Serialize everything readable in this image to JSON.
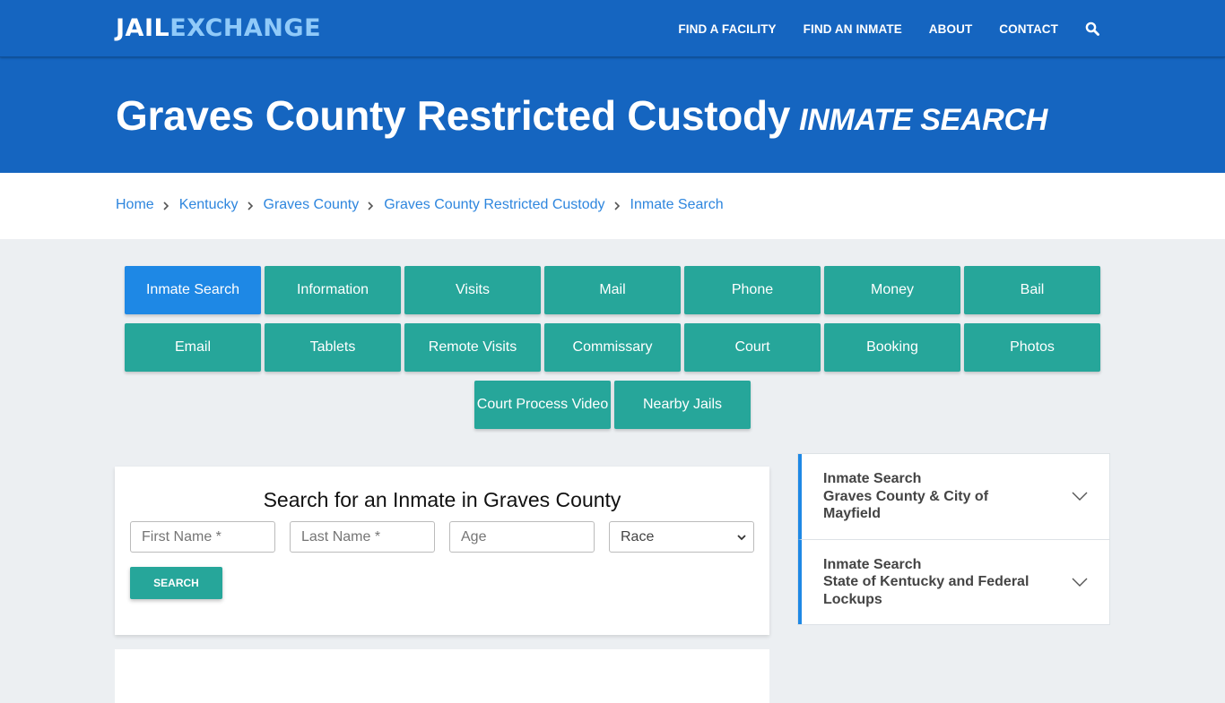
{
  "brand": {
    "part1": "JAIL",
    "part2": "EXCHANGE"
  },
  "nav": {
    "items": [
      {
        "label": "FIND A FACILITY"
      },
      {
        "label": "FIND AN INMATE"
      },
      {
        "label": "ABOUT"
      },
      {
        "label": "CONTACT"
      }
    ],
    "search_icon": "search-icon"
  },
  "hero": {
    "title": "Graves County Restricted Custody",
    "subtitle": "INMATE SEARCH"
  },
  "breadcrumb": [
    {
      "label": "Home"
    },
    {
      "label": "Kentucky"
    },
    {
      "label": "Graves County"
    },
    {
      "label": "Graves County Restricted Custody"
    },
    {
      "label": "Inmate Search"
    }
  ],
  "tabs": {
    "row1": [
      "Inmate Search",
      "Information",
      "Visits",
      "Mail",
      "Phone",
      "Money",
      "Bail"
    ],
    "row2": [
      "Email",
      "Tablets",
      "Remote Visits",
      "Commissary",
      "Court",
      "Booking",
      "Photos"
    ],
    "row3": [
      "Court Process Video",
      "Nearby Jails"
    ],
    "active": "Inmate Search"
  },
  "search_form": {
    "heading": "Search for an Inmate in Graves County",
    "first_name_placeholder": "First Name *",
    "last_name_placeholder": "Last Name *",
    "age_placeholder": "Age",
    "race_selected": "Race",
    "submit_label": "SEARCH"
  },
  "sidebar": {
    "items": [
      {
        "line1": "Inmate Search",
        "line2": "Graves County & City of Mayfield"
      },
      {
        "line1": "Inmate Search",
        "line2": "State of Kentucky and Federal Lockups"
      }
    ]
  },
  "colors": {
    "header_blue": "#1565c0",
    "logo_accent": "#90caf9",
    "tab_teal": "#26a69a",
    "tab_active_blue": "#1e88e5",
    "link_blue": "#2e86de"
  }
}
